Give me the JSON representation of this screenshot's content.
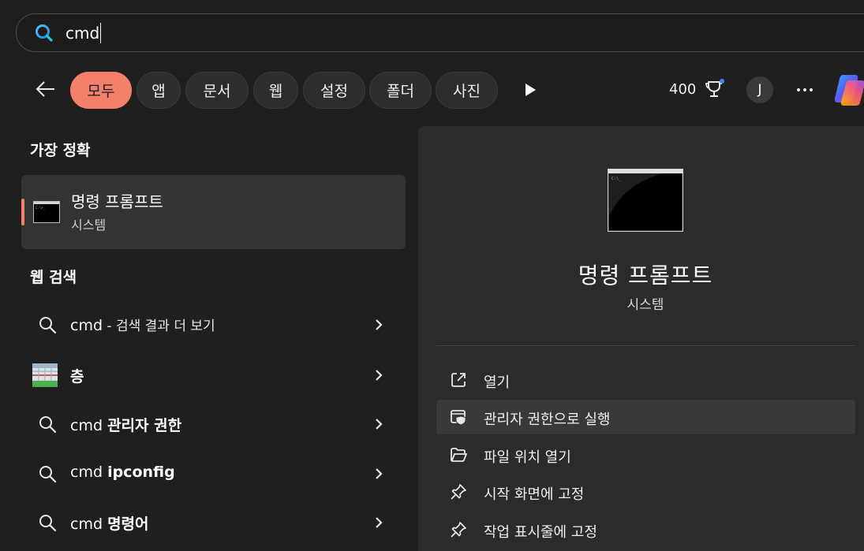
{
  "search": {
    "query": "cmd"
  },
  "filters": [
    {
      "label": "모두",
      "active": true
    },
    {
      "label": "앱"
    },
    {
      "label": "문서"
    },
    {
      "label": "웹"
    },
    {
      "label": "설정"
    },
    {
      "label": "폴더"
    },
    {
      "label": "사진"
    }
  ],
  "header": {
    "points": "400",
    "avatar_initial": "J"
  },
  "best_match": {
    "heading": "가장 정확",
    "title": "명령 프롬프트",
    "subtitle": "시스템"
  },
  "web_search": {
    "heading": "웹 검색",
    "items": [
      {
        "icon": "search-icon",
        "prefix": "cmd",
        "rest": " - 검색 결과 더 보기"
      },
      {
        "icon": "layers-image-icon",
        "prefix": "",
        "rest": "층"
      },
      {
        "icon": "search-icon",
        "prefix": "cmd ",
        "rest": "관리자 권한"
      },
      {
        "icon": "search-icon",
        "prefix": "cmd ",
        "rest": "ipconfig"
      },
      {
        "icon": "search-icon",
        "prefix": "cmd ",
        "rest": "명령어"
      }
    ]
  },
  "details": {
    "title": "명령 프롬프트",
    "subtitle": "시스템",
    "actions": [
      {
        "icon": "open-external-icon",
        "label": "열기"
      },
      {
        "icon": "shield-admin-icon",
        "label": "관리자 권한으로 실행"
      },
      {
        "icon": "folder-open-icon",
        "label": "파일 위치 열기"
      },
      {
        "icon": "pin-icon",
        "label": "시작 화면에 고정"
      },
      {
        "icon": "pin-icon",
        "label": "작업 표시줄에 고정"
      }
    ]
  },
  "colors": {
    "accent": "#f4806b",
    "background": "#1f1f1f",
    "panel": "#2b2b2b"
  }
}
